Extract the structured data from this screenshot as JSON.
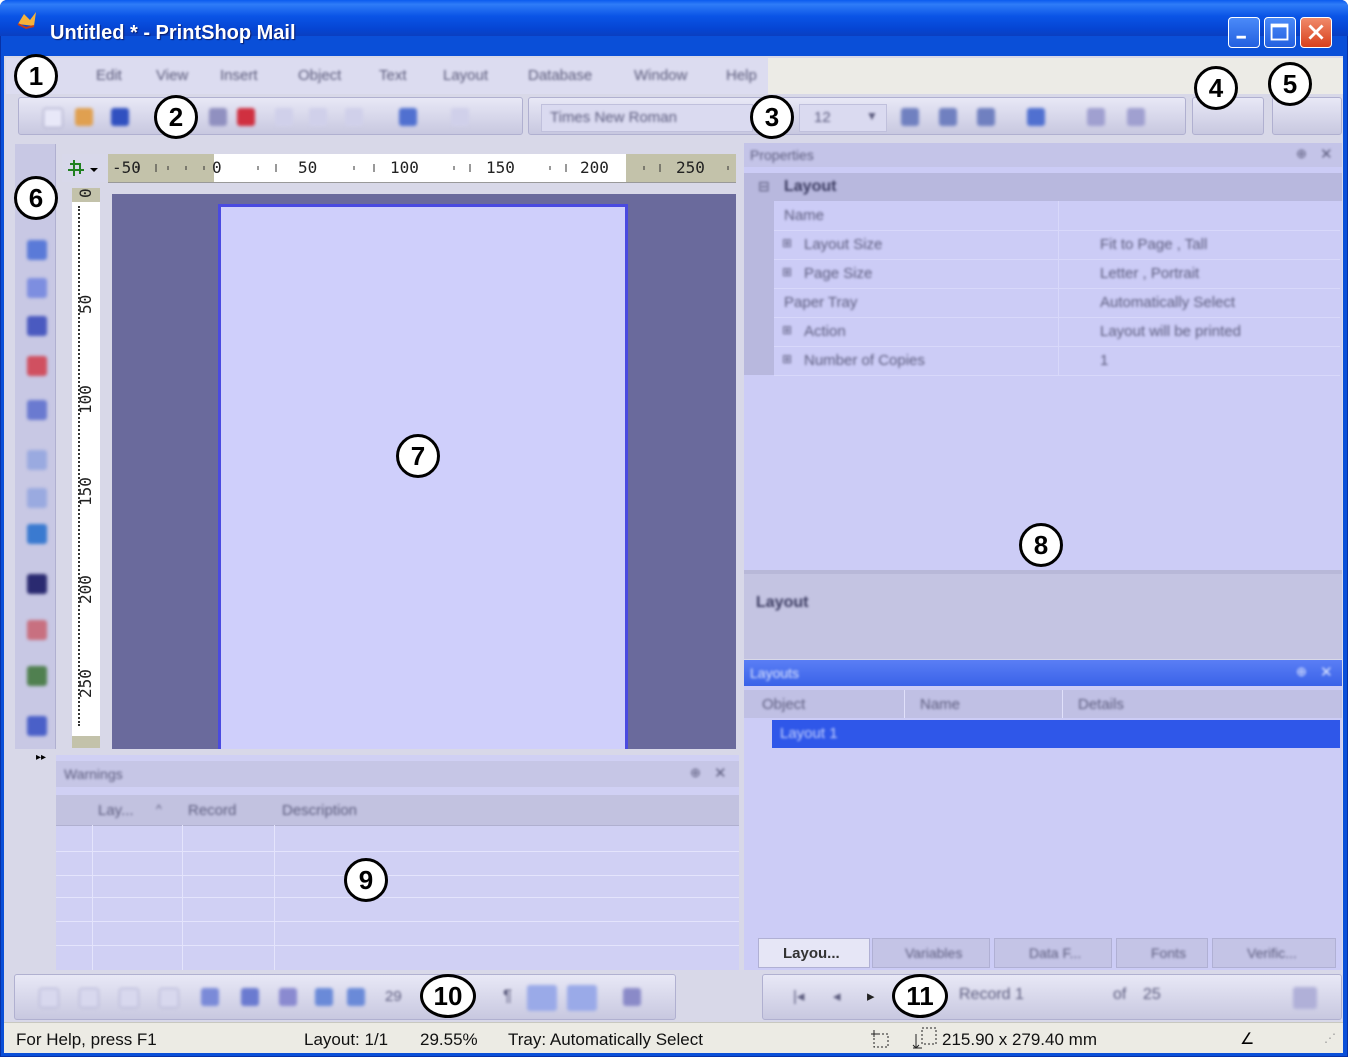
{
  "window": {
    "title": "Untitled * - PrintShop Mail"
  },
  "menu": {
    "items": [
      "Edit",
      "View",
      "Insert",
      "Object",
      "Text",
      "Layout",
      "Database",
      "Window",
      "Help"
    ]
  },
  "format_toolbar": {
    "font": "Times New Roman",
    "size": "12"
  },
  "rulers": {
    "horizontal": [
      "-50",
      "0",
      "50",
      "100",
      "150",
      "200",
      "250"
    ],
    "vertical": [
      "0",
      "50",
      "100",
      "150",
      "200",
      "250"
    ]
  },
  "properties": {
    "title": "Properties",
    "category": "Layout",
    "rows": [
      {
        "name": "Name",
        "value": ""
      },
      {
        "name": "Layout Size",
        "value": "Fit to Page , Tall"
      },
      {
        "name": "Page Size",
        "value": "Letter , Portrait"
      },
      {
        "name": "Paper Tray",
        "value": "Automatically Select"
      },
      {
        "name": "Action",
        "value": "Layout will be printed"
      },
      {
        "name": "Number of Copies",
        "value": "1"
      }
    ],
    "description": "Layout"
  },
  "layouts_panel": {
    "title": "Layouts",
    "columns": [
      "Object",
      "Name",
      "Details"
    ],
    "row": "Layout 1",
    "tabs": [
      "Layou...",
      "Variables",
      "Data F...",
      "Fonts",
      "Verific..."
    ]
  },
  "warnings_panel": {
    "title": "Warnings",
    "columns": [
      "Lay...",
      "Record",
      "Description"
    ]
  },
  "view_toolbar": {
    "zoom": "29"
  },
  "record_toolbar": {
    "label": "Record",
    "current": "1",
    "of_label": "of",
    "total": "25"
  },
  "statusbar": {
    "help": "For Help, press F1",
    "layout": "Layout: 1/1",
    "zoom": "29.55%",
    "tray": "Tray: Automatically Select",
    "size": "215.90 x 279.40 mm"
  },
  "callouts": [
    "1",
    "2",
    "3",
    "4",
    "5",
    "6",
    "7",
    "8",
    "9",
    "10",
    "11"
  ]
}
